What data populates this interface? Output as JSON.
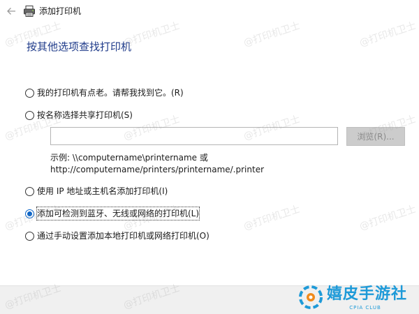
{
  "window": {
    "title": "添加打印机",
    "back_icon": "back-arrow-icon",
    "app_icon": "printer-icon"
  },
  "heading": "按其他选项查找打印机",
  "options": [
    {
      "label": "我的打印机有点老。请帮我找到它。(R)",
      "checked": false
    },
    {
      "label": "按名称选择共享打印机(S)",
      "checked": false
    },
    {
      "label": "使用 IP 地址或主机名添加打印机(I)",
      "checked": false
    },
    {
      "label": "添加可检测到蓝牙、无线或网络的打印机(L)",
      "checked": true
    },
    {
      "label": "通过手动设置添加本地打印机或网络打印机(O)",
      "checked": false
    }
  ],
  "shared_printer": {
    "input_value": "",
    "browse_label": "浏览(R)...",
    "example_line1": "示例: \\\\computername\\printername 或",
    "example_line2": "http://computername/printers/printername/.printer"
  },
  "watermark": "@打印机卫士",
  "brand": {
    "name": "嬉皮手游社",
    "sub": "CPIA CLUB",
    "colors": {
      "accent": "#1e9ad8",
      "orange": "#f08a1c"
    }
  },
  "colors": {
    "heading": "#1f3b8a",
    "radio_selected": "#0a64c8",
    "footer_bg": "#f0f0f0"
  }
}
